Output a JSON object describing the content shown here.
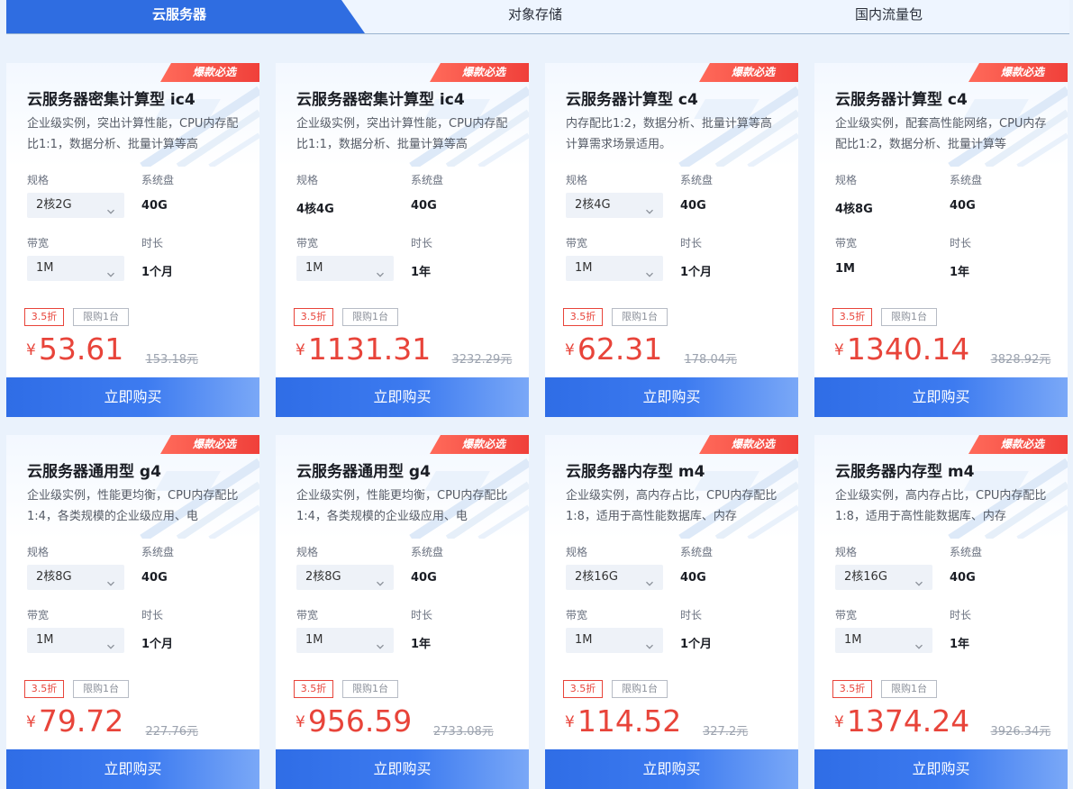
{
  "tabs": [
    {
      "label": "云服务器"
    },
    {
      "label": "对象存储"
    },
    {
      "label": "国内流量包"
    }
  ],
  "labels": {
    "spec": "规格",
    "disk": "系统盘",
    "bandwidth": "带宽",
    "duration": "时长",
    "badge": "爆款必选",
    "buy": "立即购买",
    "yen": "¥",
    "limit": "限购1台"
  },
  "colors": {
    "accent": "#2f6de1",
    "price": "#e8443a",
    "badge": "#f0403a"
  },
  "cards": [
    {
      "title": "云服务器密集计算型 ic4",
      "desc": "企业级实例，突出计算性能，CPU内存配比1:1，数据分析、批量计算等高",
      "spec": "2核2G",
      "spec_dropdown": true,
      "disk": "40G",
      "bandwidth": "1M",
      "bandwidth_dropdown": true,
      "duration": "1个月",
      "discount": "3.5折",
      "price": "53.61",
      "original": "153.18元"
    },
    {
      "title": "云服务器密集计算型 ic4",
      "desc": "企业级实例，突出计算性能，CPU内存配比1:1，数据分析、批量计算等高",
      "spec": "4核4G",
      "spec_dropdown": false,
      "disk": "40G",
      "bandwidth": "1M",
      "bandwidth_dropdown": true,
      "duration": "1年",
      "discount": "3.5折",
      "price": "1131.31",
      "original": "3232.29元"
    },
    {
      "title": "云服务器计算型 c4",
      "desc": "内存配比1:2，数据分析、批量计算等高计算需求场景适用。",
      "spec": "2核4G",
      "spec_dropdown": true,
      "disk": "40G",
      "bandwidth": "1M",
      "bandwidth_dropdown": true,
      "duration": "1个月",
      "discount": "3.5折",
      "price": "62.31",
      "original": "178.04元"
    },
    {
      "title": "云服务器计算型 c4",
      "desc": "企业级实例，配套高性能网络，CPU内存配比1:2，数据分析、批量计算等",
      "spec": "4核8G",
      "spec_dropdown": false,
      "disk": "40G",
      "bandwidth": "1M",
      "bandwidth_dropdown": false,
      "duration": "1年",
      "discount": "3.5折",
      "price": "1340.14",
      "original": "3828.92元"
    },
    {
      "title": "云服务器通用型 g4",
      "desc": "企业级实例，性能更均衡，CPU内存配比1:4，各类规模的企业级应用、电",
      "spec": "2核8G",
      "spec_dropdown": true,
      "disk": "40G",
      "bandwidth": "1M",
      "bandwidth_dropdown": true,
      "duration": "1个月",
      "discount": "3.5折",
      "price": "79.72",
      "original": "227.76元"
    },
    {
      "title": "云服务器通用型 g4",
      "desc": "企业级实例，性能更均衡，CPU内存配比1:4，各类规模的企业级应用、电",
      "spec": "2核8G",
      "spec_dropdown": true,
      "disk": "40G",
      "bandwidth": "1M",
      "bandwidth_dropdown": true,
      "duration": "1年",
      "discount": "3.5折",
      "price": "956.59",
      "original": "2733.08元"
    },
    {
      "title": "云服务器内存型 m4",
      "desc": "企业级实例，高内存占比，CPU内存配比1:8，适用于高性能数据库、内存",
      "spec": "2核16G",
      "spec_dropdown": true,
      "disk": "40G",
      "bandwidth": "1M",
      "bandwidth_dropdown": true,
      "duration": "1个月",
      "discount": "3.5折",
      "price": "114.52",
      "original": "327.2元"
    },
    {
      "title": "云服务器内存型 m4",
      "desc": "企业级实例，高内存占比，CPU内存配比1:8，适用于高性能数据库、内存",
      "spec": "2核16G",
      "spec_dropdown": true,
      "disk": "40G",
      "bandwidth": "1M",
      "bandwidth_dropdown": true,
      "duration": "1年",
      "discount": "3.5折",
      "price": "1374.24",
      "original": "3926.34元"
    }
  ]
}
